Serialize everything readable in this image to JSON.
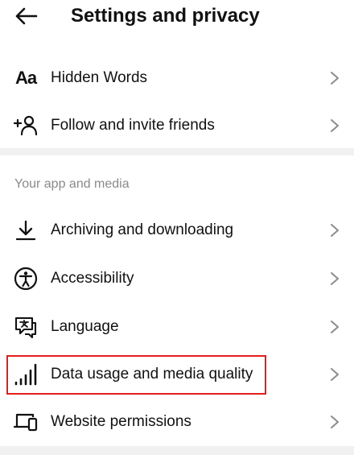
{
  "header": {
    "back_icon": "arrow-left-icon",
    "title": "Settings and privacy"
  },
  "group1": {
    "items": [
      {
        "label": "Hidden Words",
        "icon": "text-size-icon",
        "icon_text": "Aa"
      },
      {
        "label": "Follow and invite friends",
        "icon": "add-person-icon"
      }
    ]
  },
  "section": {
    "title": "Your app and media",
    "items": [
      {
        "label": "Archiving and downloading",
        "icon": "download-icon"
      },
      {
        "label": "Accessibility",
        "icon": "accessibility-icon"
      },
      {
        "label": "Language",
        "icon": "language-icon"
      },
      {
        "label": "Data usage and media quality",
        "icon": "signal-bars-icon",
        "highlighted": true
      },
      {
        "label": "Website permissions",
        "icon": "devices-icon"
      }
    ]
  },
  "colors": {
    "highlight_border": "#e31d1d",
    "divider": "#f1f1f1",
    "section_title": "#8a8a8a",
    "chevron": "#8c8c8c"
  }
}
